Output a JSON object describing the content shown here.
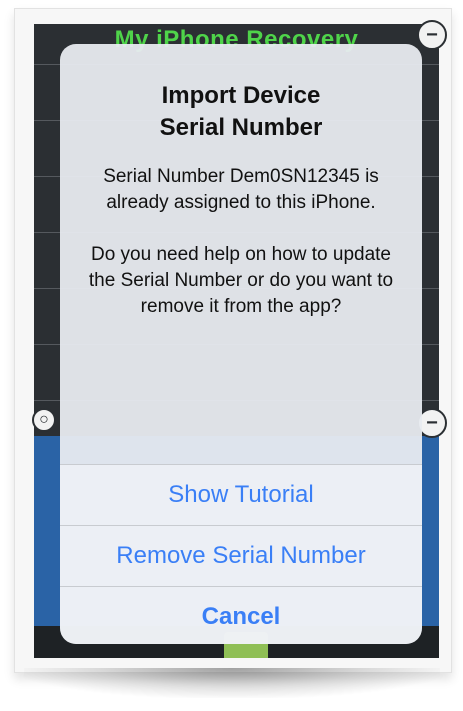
{
  "background_app": {
    "title": "My iPhone Recovery"
  },
  "alert": {
    "title_line1": "Import Device",
    "title_line2": "Serial Number",
    "message_part1": "Serial Number Dem0SN12345 is already assigned to this iPhone.",
    "message_part2": "Do you need help on how to update the Serial Number or do you want to remove it from the app?",
    "actions": [
      {
        "label": "Show Tutorial"
      },
      {
        "label": "Remove Serial Number"
      },
      {
        "label": "Cancel"
      }
    ]
  },
  "colors": {
    "action_blue": "#3a7ff6",
    "title_green": "#4fd44a",
    "list_blue": "#2a63a6"
  }
}
